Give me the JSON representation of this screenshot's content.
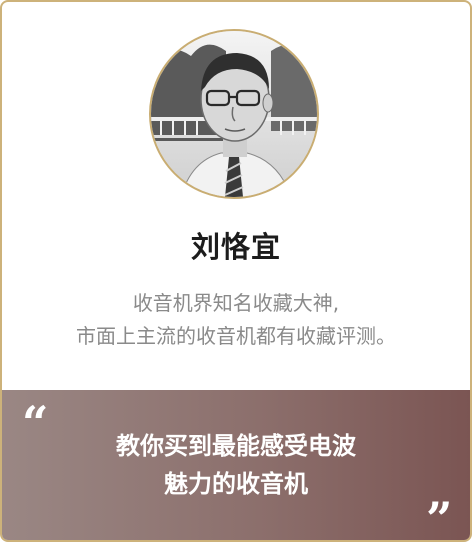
{
  "profile": {
    "name": "刘恪宜",
    "description_line1": "收音机界知名收藏大神,",
    "description_line2": "市面上主流的收音机都有收藏评测。"
  },
  "quote": {
    "open_mark": "“",
    "line1": "教你买到最能感受电波",
    "line2": "魅力的收音机",
    "close_mark": "”"
  },
  "colors": {
    "border": "#cdb27a",
    "quote_band_start": "#9a8784",
    "quote_band_end": "#7b5553",
    "name": "#1c1c1c",
    "description": "#8a8a8a"
  }
}
